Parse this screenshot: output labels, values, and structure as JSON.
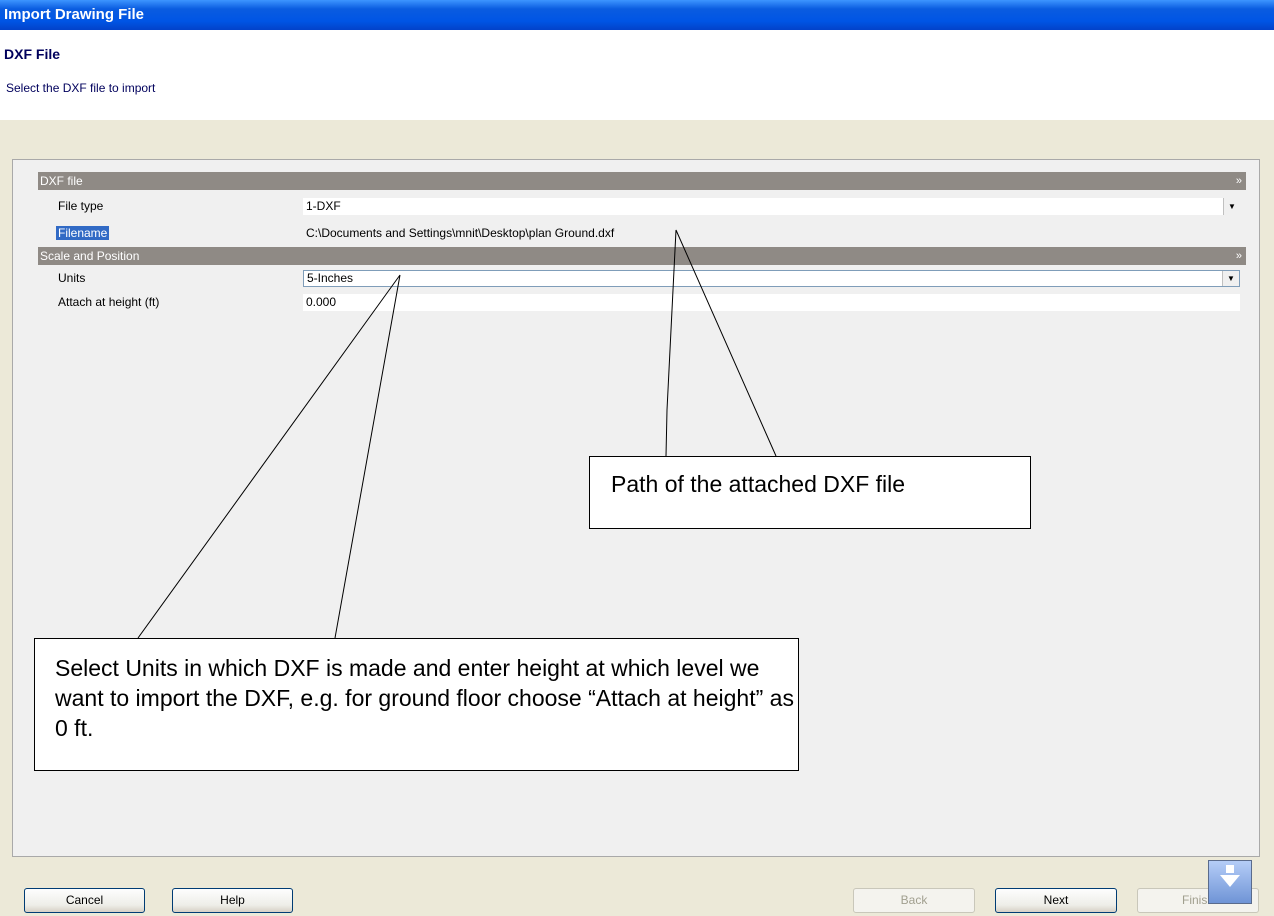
{
  "window": {
    "title": "Import Drawing File"
  },
  "header": {
    "title": "DXF File",
    "subtitle": "Select the DXF file to import"
  },
  "sections": {
    "dxf_file": {
      "title": "DXF file",
      "file_type_label": "File type",
      "file_type_value": "1-DXF",
      "filename_label": "Filename",
      "filename_value": "C:\\Documents and Settings\\mnit\\Desktop\\plan Ground.dxf"
    },
    "scale_position": {
      "title": "Scale and Position",
      "units_label": "Units",
      "units_value": "5-Inches",
      "height_label": "Attach at height (ft)",
      "height_value": "0.000"
    }
  },
  "callouts": {
    "path_note": "Path of the attached DXF file",
    "units_note": "Select Units in which DXF is made and enter height at which level we want to import the DXF, e.g. for ground floor choose “Attach at height” as 0 ft."
  },
  "buttons": {
    "cancel": "Cancel",
    "help": "Help",
    "back": "Back",
    "next": "Next",
    "finish": "Finish"
  },
  "icons": {
    "collapse": "double-chevron-up-icon",
    "dropdown": "dropdown-arrow-icon",
    "scroll": "scroll-down-icon"
  },
  "colors": {
    "titlebar": "#0055e5",
    "header_text": "#00005c",
    "section_bar": "#8f8a85",
    "selection": "#316ac5"
  }
}
